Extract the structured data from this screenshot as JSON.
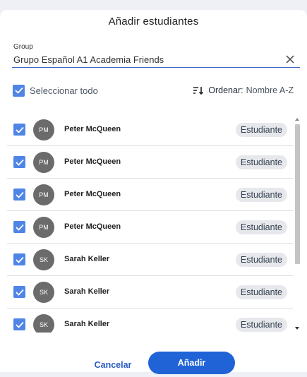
{
  "dialog": {
    "title": "Añadir estudiantes",
    "group": {
      "label": "Group",
      "value": "Grupo Español A1 Academia Friends"
    },
    "select_all": {
      "label": "Seleccionar todo",
      "checked": true
    },
    "sort": {
      "label": "Ordenar:",
      "value": "Nombre A-Z"
    },
    "students": [
      {
        "initials": "PM",
        "name": "Peter McQueen",
        "role": "Estudiante",
        "checked": true
      },
      {
        "initials": "PM",
        "name": "Peter McQueen",
        "role": "Estudiante",
        "checked": true
      },
      {
        "initials": "PM",
        "name": "Peter McQueen",
        "role": "Estudiante",
        "checked": true
      },
      {
        "initials": "PM",
        "name": "Peter McQueen",
        "role": "Estudiante",
        "checked": true
      },
      {
        "initials": "SK",
        "name": "Sarah Keller",
        "role": "Estudiante",
        "checked": true
      },
      {
        "initials": "SK",
        "name": "Sarah Keller",
        "role": "Estudiante",
        "checked": true
      },
      {
        "initials": "SK",
        "name": "Sarah Keller",
        "role": "Estudiante",
        "checked": true
      }
    ],
    "buttons": {
      "cancel": "Cancelar",
      "add": "Añadir"
    },
    "colors": {
      "accent": "#1f63d6",
      "checkbox": "#4f86e6",
      "avatar": "#6b6b6b",
      "chip": "#e6e8ec"
    },
    "icons": {
      "clear": "close-icon",
      "sort": "sort-icon",
      "check": "check-icon"
    }
  }
}
